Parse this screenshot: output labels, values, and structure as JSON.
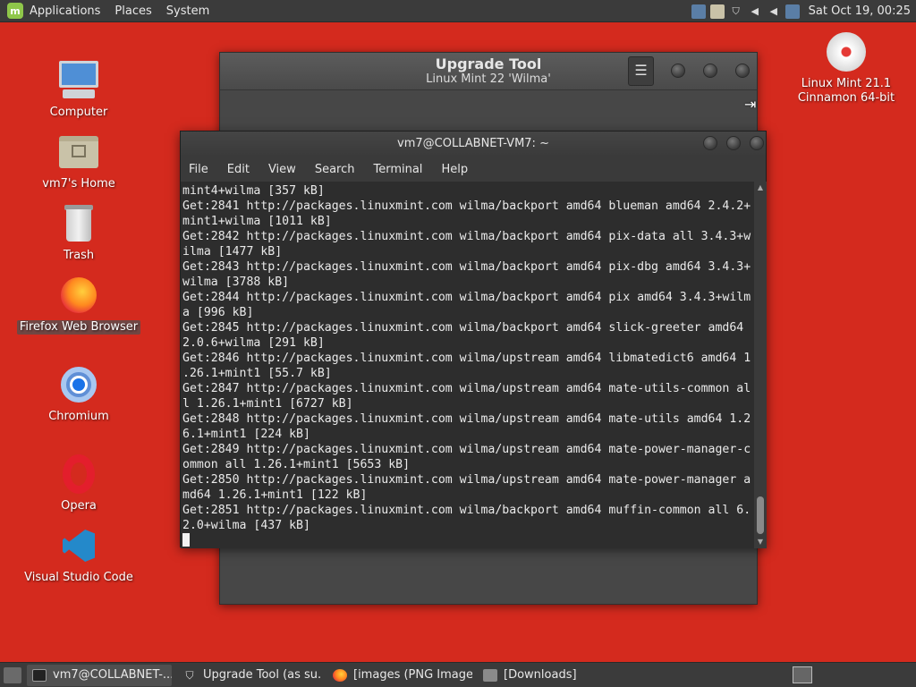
{
  "top_panel": {
    "menu": [
      "Applications",
      "Places",
      "System"
    ],
    "clock": "Sat Oct 19, 00:25"
  },
  "desktop": {
    "icons": [
      {
        "label": "Computer"
      },
      {
        "label": "vm7's Home"
      },
      {
        "label": "Trash"
      },
      {
        "label": "Firefox Web Browser"
      },
      {
        "label": "Chromium"
      },
      {
        "label": "Opera"
      },
      {
        "label": "Visual Studio Code"
      }
    ],
    "disc": {
      "line1": "Linux Mint 21.1",
      "line2": "Cinnamon 64-bit"
    }
  },
  "upgrade_window": {
    "title": "Upgrade Tool",
    "subtitle": "Linux Mint 22 'Wilma'",
    "menu_icon": "☰"
  },
  "terminal": {
    "title": "vm7@COLLABNET-VM7: ~",
    "menu": [
      "File",
      "Edit",
      "View",
      "Search",
      "Terminal",
      "Help"
    ],
    "lines": [
      "mint4+wilma [357 kB]",
      "Get:2841 http://packages.linuxmint.com wilma/backport amd64 blueman amd64 2.4.2+",
      "mint1+wilma [1011 kB]",
      "Get:2842 http://packages.linuxmint.com wilma/backport amd64 pix-data all 3.4.3+w",
      "ilma [1477 kB]",
      "Get:2843 http://packages.linuxmint.com wilma/backport amd64 pix-dbg amd64 3.4.3+",
      "wilma [3788 kB]",
      "Get:2844 http://packages.linuxmint.com wilma/backport amd64 pix amd64 3.4.3+wilm",
      "a [996 kB]",
      "Get:2845 http://packages.linuxmint.com wilma/backport amd64 slick-greeter amd64",
      "2.0.6+wilma [291 kB]",
      "Get:2846 http://packages.linuxmint.com wilma/upstream amd64 libmatedict6 amd64 1",
      ".26.1+mint1 [55.7 kB]",
      "Get:2847 http://packages.linuxmint.com wilma/upstream amd64 mate-utils-common al",
      "l 1.26.1+mint1 [6727 kB]",
      "Get:2848 http://packages.linuxmint.com wilma/upstream amd64 mate-utils amd64 1.2",
      "6.1+mint1 [224 kB]",
      "Get:2849 http://packages.linuxmint.com wilma/upstream amd64 mate-power-manager-c",
      "ommon all 1.26.1+mint1 [5653 kB]",
      "Get:2850 http://packages.linuxmint.com wilma/upstream amd64 mate-power-manager a",
      "md64 1.26.1+mint1 [122 kB]",
      "Get:2851 http://packages.linuxmint.com wilma/backport amd64 muffin-common all 6.",
      "2.0+wilma [437 kB]"
    ]
  },
  "taskbar": {
    "items": [
      {
        "label": "vm7@COLLABNET-...",
        "icon": "terminal-icon"
      },
      {
        "label": "Upgrade Tool (as su...",
        "icon": "shield-icon"
      },
      {
        "label": "[images (PNG Image...",
        "icon": "firefox-icon"
      },
      {
        "label": "[Downloads]",
        "icon": "folder-icon"
      }
    ]
  },
  "colors": {
    "desktop_bg": "#d42a1e",
    "panel_bg": "#3b3b3b",
    "terminal_bg": "#2d2d2d",
    "window_bg": "#474747"
  }
}
